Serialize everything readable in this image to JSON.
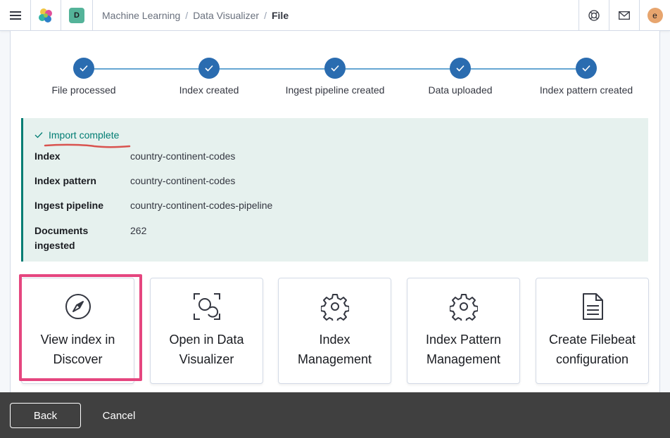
{
  "header": {
    "space_initial": "D",
    "avatar_initial": "e",
    "breadcrumbs": [
      "Machine Learning",
      "Data Visualizer",
      "File"
    ]
  },
  "steps": [
    {
      "label": "File processed",
      "status": "complete"
    },
    {
      "label": "Index created",
      "status": "complete"
    },
    {
      "label": "Ingest pipeline created",
      "status": "complete"
    },
    {
      "label": "Data uploaded",
      "status": "complete"
    },
    {
      "label": "Index pattern created",
      "status": "complete"
    }
  ],
  "callout": {
    "title": "Import complete",
    "rows": [
      {
        "key": "Index",
        "value": "country-continent-codes"
      },
      {
        "key": "Index pattern",
        "value": "country-continent-codes"
      },
      {
        "key": "Ingest pipeline",
        "value": "country-continent-codes-pipeline"
      },
      {
        "key": "Documents ingested",
        "value": "262"
      }
    ]
  },
  "cards": [
    {
      "label": "View index in Discover",
      "icon": "compass-icon"
    },
    {
      "label": "Open in Data Visualizer",
      "icon": "data-visualizer-icon"
    },
    {
      "label": "Index Management",
      "icon": "gear-icon"
    },
    {
      "label": "Index Pattern Management",
      "icon": "gear-icon"
    },
    {
      "label": "Create Filebeat configuration",
      "icon": "document-icon"
    }
  ],
  "footer": {
    "back_label": "Back",
    "cancel_label": "Cancel"
  },
  "colors": {
    "primary": "#2a6cb0",
    "success": "#017d73",
    "highlight": "#e5467f",
    "footer_bg": "#404040"
  }
}
